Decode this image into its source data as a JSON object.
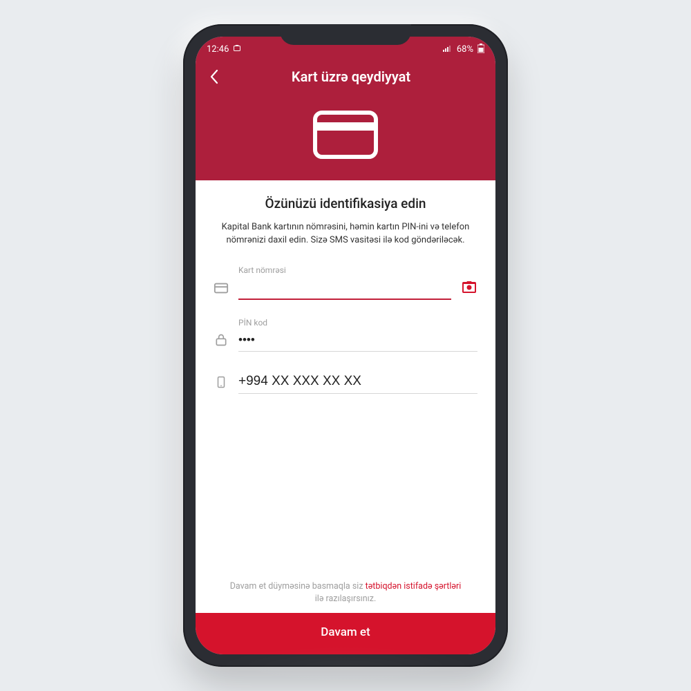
{
  "status": {
    "time": "12:46",
    "battery": "68%"
  },
  "header": {
    "title": "Kart üzrə qeydiyyat"
  },
  "content": {
    "heading": "Özünüzü identifikasiya edin",
    "description": "Kapital Bank kartının nömrəsini, həmin kartın PIN-ini və telefon nömrənizi daxil edin. Sizə SMS vasitəsi ilə kod göndəriləcək."
  },
  "fields": {
    "card": {
      "label": "Kart nömrəsi",
      "value": ""
    },
    "pin": {
      "label": "PİN kod",
      "value": "••••"
    },
    "phone": {
      "value": "+994 XX XXX XX XX"
    }
  },
  "terms": {
    "prefix": "Davam et düyməsinə basmaqla siz ",
    "link": "tətbiqdən istifadə şərtləri",
    "suffix": " ilə razılaşırsınız."
  },
  "cta": {
    "label": "Davam et"
  },
  "colors": {
    "headerBg": "#ad1f3c",
    "accent": "#d5132c"
  }
}
